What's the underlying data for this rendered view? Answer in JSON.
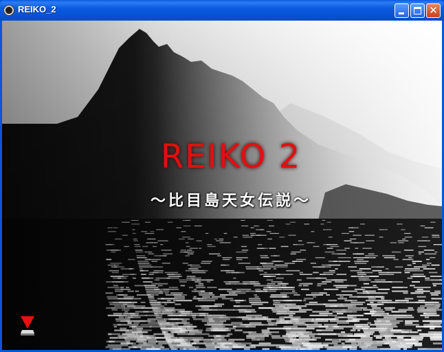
{
  "window": {
    "title": "REIKO_2",
    "minimize_icon": "minimize-icon",
    "maximize_icon": "maximize-icon",
    "close_icon": "close-icon"
  },
  "game": {
    "title": "REIKO 2",
    "subtitle": "～比目島天女伝説～",
    "title_color": "#e01010",
    "indicator_icon": "red-down-arrow-icon"
  }
}
